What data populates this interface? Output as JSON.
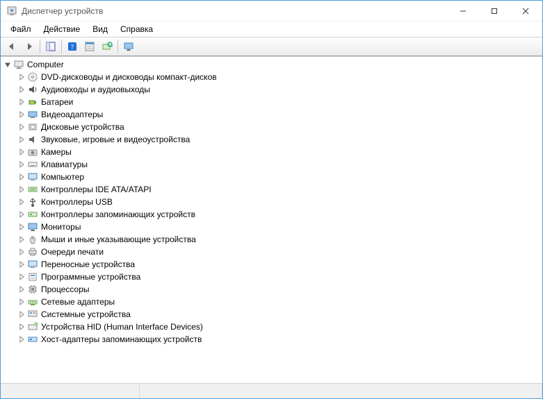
{
  "title": "Диспетчер устройств",
  "menu": {
    "file": "Файл",
    "action": "Действие",
    "view": "Вид",
    "help": "Справка"
  },
  "toolbar": {
    "back": "back",
    "forward": "forward",
    "show_hide": "show-hide-tree",
    "help": "help",
    "properties": "properties",
    "scan": "scan-hardware",
    "monitor": "display"
  },
  "root": {
    "label": "Computer",
    "expanded": true
  },
  "categories": [
    {
      "icon": "dvd",
      "label": "DVD-дисководы и дисководы компакт-дисков"
    },
    {
      "icon": "audio",
      "label": "Аудиовходы и аудиовыходы"
    },
    {
      "icon": "battery",
      "label": "Батареи"
    },
    {
      "icon": "display-adapter",
      "label": "Видеоадаптеры"
    },
    {
      "icon": "disk",
      "label": "Дисковые устройства"
    },
    {
      "icon": "sound",
      "label": "Звуковые, игровые и видеоустройства"
    },
    {
      "icon": "camera",
      "label": "Камеры"
    },
    {
      "icon": "keyboard",
      "label": "Клавиатуры"
    },
    {
      "icon": "computer",
      "label": "Компьютер"
    },
    {
      "icon": "ide",
      "label": "Контроллеры IDE ATA/ATAPI"
    },
    {
      "icon": "usb",
      "label": "Контроллеры USB"
    },
    {
      "icon": "storage-controller",
      "label": "Контроллеры запоминающих устройств"
    },
    {
      "icon": "monitor",
      "label": "Мониторы"
    },
    {
      "icon": "mouse",
      "label": "Мыши и иные указывающие устройства"
    },
    {
      "icon": "print-queue",
      "label": "Очереди печати"
    },
    {
      "icon": "portable",
      "label": "Переносные устройства"
    },
    {
      "icon": "software-device",
      "label": "Программные устройства"
    },
    {
      "icon": "cpu",
      "label": "Процессоры"
    },
    {
      "icon": "network",
      "label": "Сетевые адаптеры"
    },
    {
      "icon": "system",
      "label": "Системные устройства"
    },
    {
      "icon": "hid",
      "label": "Устройства HID (Human Interface Devices)"
    },
    {
      "icon": "host-adapter",
      "label": "Хост-адаптеры запоминающих устройств"
    }
  ]
}
